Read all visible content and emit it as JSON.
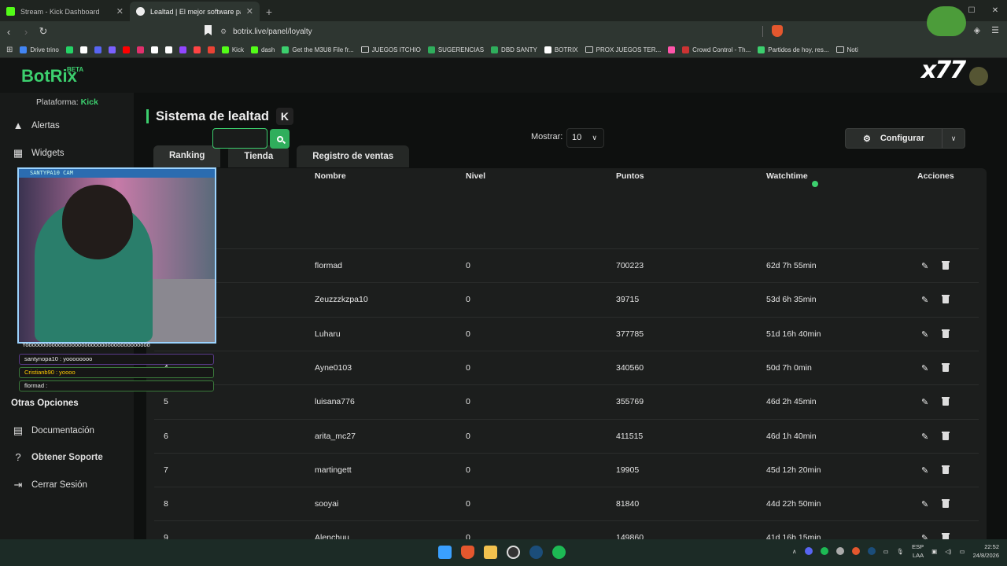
{
  "browser": {
    "tabs": [
      {
        "title": "Stream - Kick Dashboard",
        "color": "#53fc18"
      },
      {
        "title": "Lealtad | El mejor software para",
        "color": "#eeeeee"
      }
    ],
    "url": "botrix.live/panel/loyalty",
    "bookmarks": [
      {
        "label": "Drive trino",
        "icon": "drive-icon",
        "color": "#4285f4"
      },
      {
        "label": "",
        "icon": "whatsapp-icon",
        "color": "#25d366"
      },
      {
        "label": "",
        "icon": "app-icon",
        "color": "#ffffff"
      },
      {
        "label": "",
        "icon": "app-icon",
        "color": "#5865f2"
      },
      {
        "label": "",
        "icon": "app-icon",
        "color": "#7b61ff"
      },
      {
        "label": "",
        "icon": "youtube-icon",
        "color": "#ff0000"
      },
      {
        "label": "",
        "icon": "instagram-icon",
        "color": "#e1306c"
      },
      {
        "label": "",
        "icon": "tiktok-icon",
        "color": "#ffffff"
      },
      {
        "label": "",
        "icon": "x-icon",
        "color": "#ffffff"
      },
      {
        "label": "",
        "icon": "twitch-icon",
        "color": "#9146ff"
      },
      {
        "label": "",
        "icon": "app-icon",
        "color": "#ff4444"
      },
      {
        "label": "",
        "icon": "gmail-icon",
        "color": "#ea4335"
      },
      {
        "label": "Kick",
        "icon": "kick-icon",
        "color": "#53fc18"
      },
      {
        "label": "dash",
        "icon": "kick-icon",
        "color": "#53fc18"
      },
      {
        "label": "Get the M3U8 File fr...",
        "icon": "app-icon",
        "color": "#3ccf6e"
      },
      {
        "label": "JUEGOS ITCHIO",
        "icon": "folder-icon",
        "color": ""
      },
      {
        "label": "SUGERENCIAS",
        "icon": "app-icon",
        "color": "#2fae5c"
      },
      {
        "label": "DBD SANTY",
        "icon": "app-icon",
        "color": "#2fae5c"
      },
      {
        "label": "BOTRIX",
        "icon": "botrix-icon",
        "color": "#ffffff"
      },
      {
        "label": "PROX JUEGOS TER...",
        "icon": "folder-icon",
        "color": ""
      },
      {
        "label": "",
        "icon": "app-icon",
        "color": "#ff55aa"
      },
      {
        "label": "Crowd Control - Th...",
        "icon": "app-icon",
        "color": "#cc3333"
      },
      {
        "label": "Partidos de hoy, res...",
        "icon": "app-icon",
        "color": "#3ccf6e"
      },
      {
        "label": "Noti",
        "icon": "folder-icon",
        "color": ""
      }
    ]
  },
  "app": {
    "logo": "BotRix",
    "logo_badge": "BETA",
    "platform_label": "Plataforma:",
    "platform_value": "Kick",
    "nav": {
      "alertas": "Alertas",
      "widgets": "Widgets"
    },
    "other_section": "Otras Opciones",
    "other": {
      "docs": "Documentación",
      "support": "Obtener Soporte",
      "logout": "Cerrar Sesión"
    }
  },
  "page": {
    "title": "Sistema de lealtad",
    "badge": "K",
    "tabs": [
      "Ranking",
      "Tienda",
      "Registro de ventas"
    ],
    "show_label": "Mostrar:",
    "show_value": "10",
    "config_label": "Configurar",
    "columns": [
      "Nombre",
      "Nivel",
      "Puntos",
      "Watchtime",
      "Acciones"
    ],
    "rows": [
      {
        "rank": "",
        "name": "flormad",
        "level": "0",
        "points": "700223",
        "watchtime": "62d 7h 55min"
      },
      {
        "rank": "",
        "name": "Zeuzzzkzpa10",
        "level": "0",
        "points": "39715",
        "watchtime": "53d 6h 35min"
      },
      {
        "rank": "",
        "name": "Luharu",
        "level": "0",
        "points": "377785",
        "watchtime": "51d 16h 40min"
      },
      {
        "rank": "4",
        "name": "Ayne0103",
        "level": "0",
        "points": "340560",
        "watchtime": "50d 7h 0min"
      },
      {
        "rank": "5",
        "name": "luisana776",
        "level": "0",
        "points": "355769",
        "watchtime": "46d 2h 45min"
      },
      {
        "rank": "6",
        "name": "arita_mc27",
        "level": "0",
        "points": "411515",
        "watchtime": "46d 1h 40min"
      },
      {
        "rank": "7",
        "name": "martingett",
        "level": "0",
        "points": "19905",
        "watchtime": "45d 12h 20min"
      },
      {
        "rank": "8",
        "name": "sooyai",
        "level": "0",
        "points": "81840",
        "watchtime": "44d 22h 50min"
      },
      {
        "rank": "9",
        "name": "Alenchuu",
        "level": "0",
        "points": "149860",
        "watchtime": "41d 16h 15min"
      }
    ]
  },
  "overlay": {
    "cam_title": "SANTYPA10 CAM",
    "chat": [
      "Yoooooooooooooooooooooooooooooooooooooo",
      "santynopa10 : yoooooooo",
      "Cristianb90 : yoooo",
      "flormad :"
    ],
    "badge_text": "x77"
  },
  "taskbar": {
    "lang": "ESP",
    "lang2": "LAA",
    "time": "22:52",
    "date": "24/8/2026"
  }
}
